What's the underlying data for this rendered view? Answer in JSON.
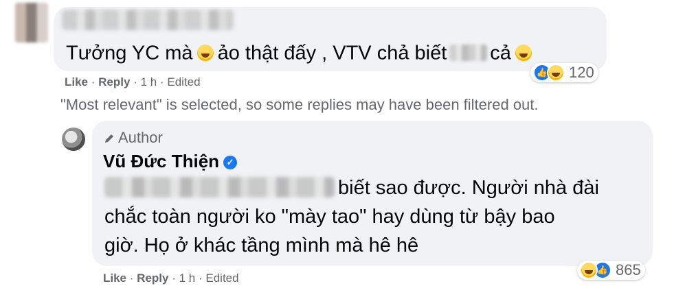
{
  "comment1": {
    "text_before": "Tưởng YC mà",
    "text_middle": "ảo thật đấy , VTV chả biết",
    "text_after": "cả",
    "reaction_count": "120",
    "actions": {
      "like": "Like",
      "sep1": "·",
      "reply": "Reply",
      "sep2": "·",
      "time": "1 h",
      "sep3": "·",
      "edited": "Edited"
    }
  },
  "filter_notice": "\"Most relevant\" is selected, so some replies may have been filtered out.",
  "comment2": {
    "badge": "Author",
    "author_name": "Vũ Đức Thiện",
    "line1": "biết sao được. Người nhà đài",
    "line2": "chắc toàn người ko \"mày tao\" hay dùng từ bậy bao",
    "line3": "giờ. Họ ở khác tầng mình mà hê hê",
    "reaction_count": "865",
    "actions": {
      "like": "Like",
      "sep1": "·",
      "reply": "Reply",
      "sep2": "·",
      "time": "1 h",
      "sep3": "·",
      "edited": "Edited"
    }
  },
  "colors": {
    "bubble": "#f0f2f5",
    "secondary_text": "#65676b",
    "primary_text": "#050505",
    "facebook_blue": "#1877f2"
  }
}
